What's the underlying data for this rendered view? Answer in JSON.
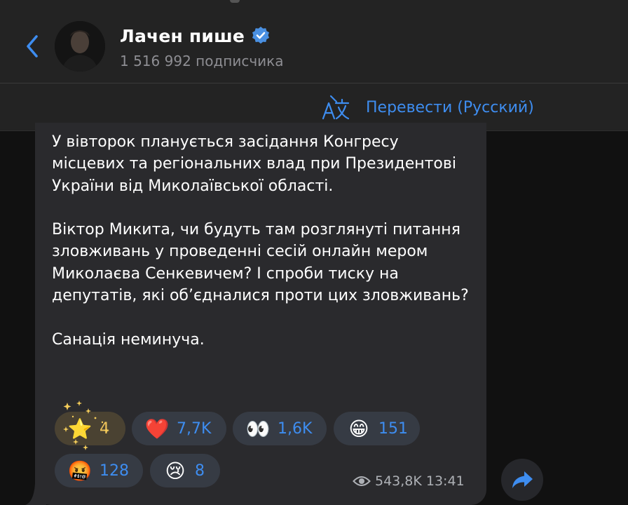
{
  "header": {
    "title": "Лачен пише",
    "subscribers": "1 516 992 подписчика",
    "back_icon": "chevron-left-icon",
    "verified_icon": "verified-badge-icon"
  },
  "translate": {
    "label": "Перевести (Русский)",
    "icon": "translate-icon"
  },
  "message": {
    "paragraphs": [
      "У вівторок планується засідання Конгресу місцевих та регіональних влад при Президентові України від Миколаївської області.",
      "Віктор Микита, чи будуть там розглянуті питання зловживань у проведенні сесій онлайн мером Миколаєва Сенкевичем? І спроби тиску на депутатів, які об’єдналися проти цих зловживань?",
      "Санація неминуча."
    ],
    "views": "543,8K",
    "time": "13:41"
  },
  "reactions": [
    {
      "emoji": "⭐",
      "icon": "star-icon",
      "count": "4"
    },
    {
      "emoji": "❤️",
      "icon": "heart-icon",
      "count": "7,7K"
    },
    {
      "emoji": "👀",
      "icon": "eyes-icon",
      "count": "1,6K"
    },
    {
      "emoji": "😁",
      "icon": "grin-icon",
      "count": "151"
    },
    {
      "emoji": "🤬",
      "icon": "cursing-face-icon",
      "count": "128"
    },
    {
      "emoji": "😢",
      "icon": "crying-face-icon",
      "count": "8"
    }
  ],
  "colors": {
    "accent": "#3e8df0",
    "header_bg": "#232323",
    "bubble_bg": "#2a2a2d",
    "reaction_bg": "#363b44"
  }
}
